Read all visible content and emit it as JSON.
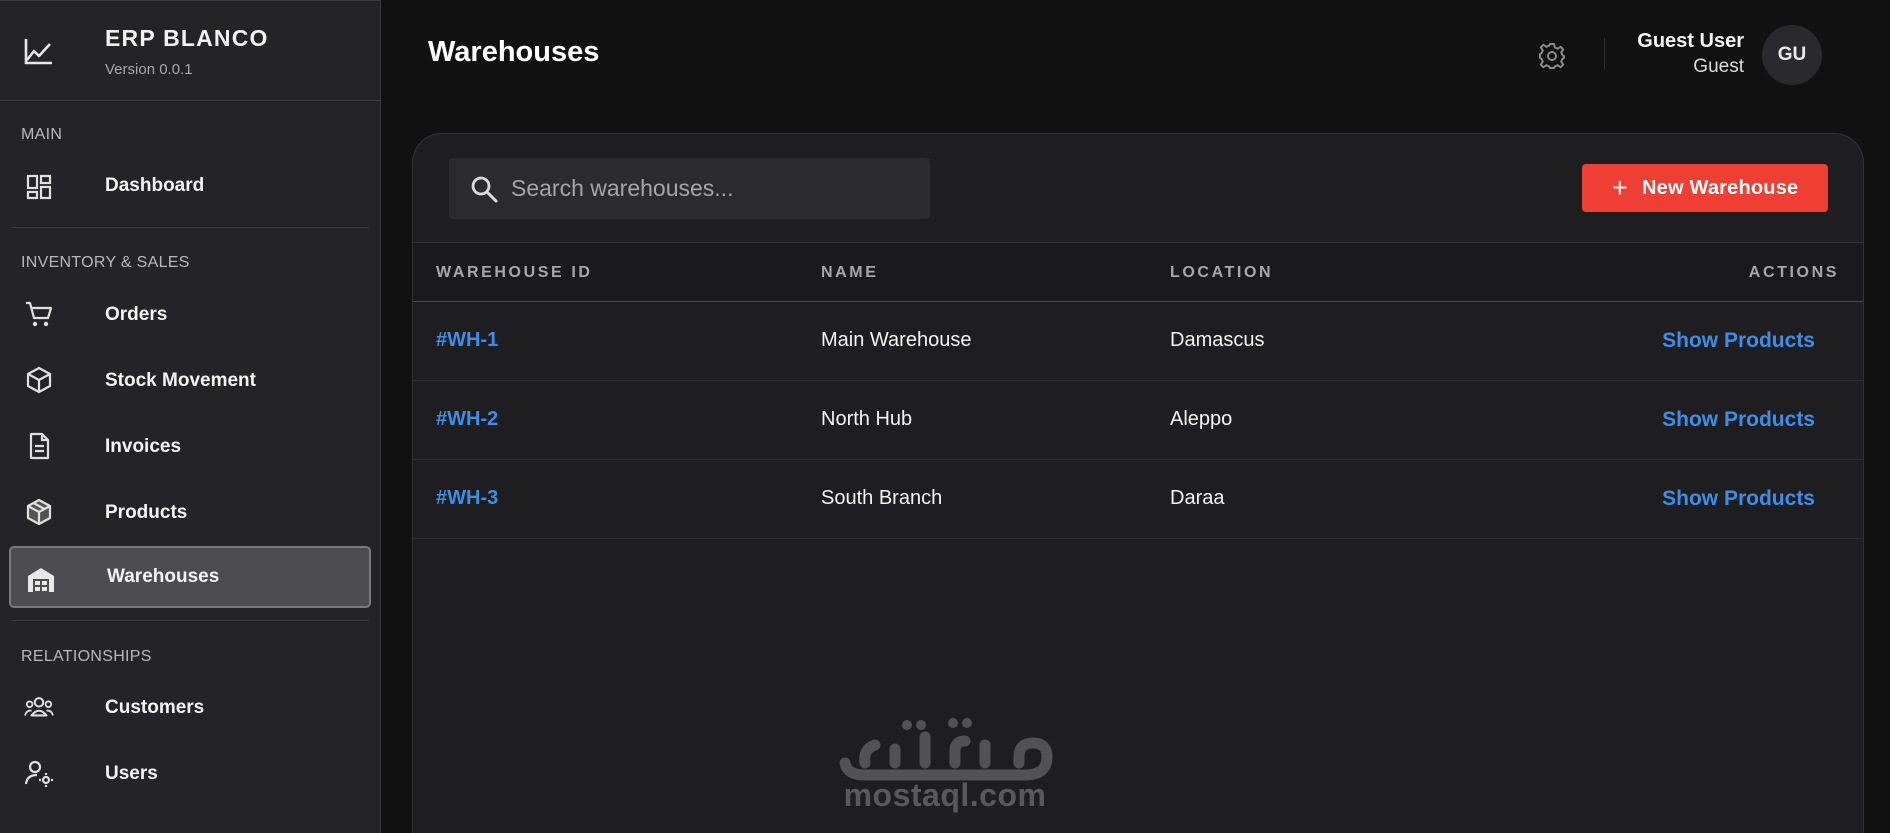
{
  "brand": {
    "name": "ERP BLANCO",
    "version": "Version 0.0.1",
    "icon": "line-chart-icon"
  },
  "sidebar": {
    "sections": [
      {
        "label": "MAIN",
        "items": [
          {
            "label": "Dashboard",
            "icon": "dashboard-icon",
            "active": false
          }
        ]
      },
      {
        "label": "INVENTORY & SALES",
        "items": [
          {
            "label": "Orders",
            "icon": "cart-icon",
            "active": false
          },
          {
            "label": "Stock Movement",
            "icon": "package-icon",
            "active": false
          },
          {
            "label": "Invoices",
            "icon": "document-icon",
            "active": false
          },
          {
            "label": "Products",
            "icon": "boxes-icon",
            "active": false
          },
          {
            "label": "Warehouses",
            "icon": "warehouse-icon",
            "active": true
          }
        ]
      },
      {
        "label": "RELATIONSHIPS",
        "items": [
          {
            "label": "Customers",
            "icon": "customers-icon",
            "active": false
          },
          {
            "label": "Users",
            "icon": "user-settings-icon",
            "active": false
          }
        ]
      }
    ]
  },
  "header": {
    "title": "Warehouses",
    "settings_icon": "gear-icon",
    "user": {
      "name": "Guest User",
      "role": "Guest",
      "initials": "GU"
    }
  },
  "toolbar": {
    "search_placeholder": "Search warehouses...",
    "search_value": "",
    "new_button_label": "New Warehouse",
    "new_button_icon": "plus-icon",
    "accent_color": "#ef3e33"
  },
  "table": {
    "columns": [
      "WAREHOUSE ID",
      "NAME",
      "LOCATION",
      "ACTIONS"
    ],
    "rows": [
      {
        "id": "#WH-1",
        "name": "Main Warehouse",
        "location": "Damascus",
        "action": "Show Products"
      },
      {
        "id": "#WH-2",
        "name": "North Hub",
        "location": "Aleppo",
        "action": "Show Products"
      },
      {
        "id": "#WH-3",
        "name": "South Branch",
        "location": "Daraa",
        "action": "Show Products"
      }
    ],
    "link_color": "#3d8ee8"
  },
  "watermark": {
    "arabic": "مستقل",
    "latin": "mostaql.com"
  }
}
